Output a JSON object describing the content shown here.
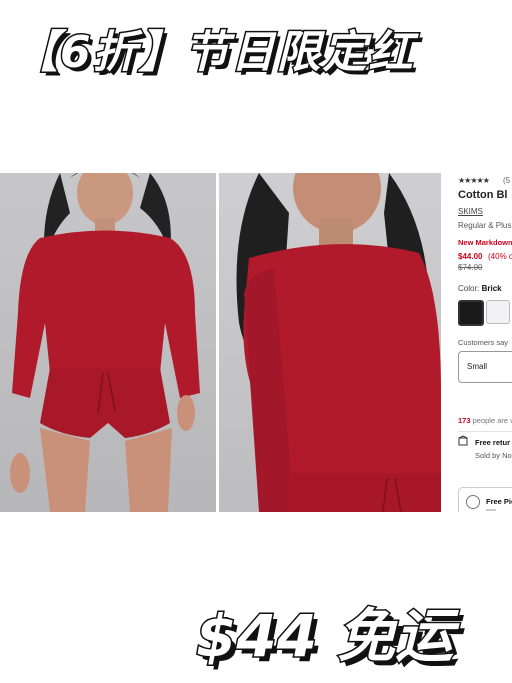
{
  "banner_top": {
    "text": "【6折】节日限定红"
  },
  "banner_bottom": {
    "text": "$44 免运"
  },
  "product": {
    "rating_stars": "★★★★★",
    "review_count": "(5",
    "title": "Cotton Bl",
    "brand": "SKIMS",
    "sizes": "Regular & Plus",
    "markdown_label": "New Markdown",
    "price": "$44.00",
    "discount": "(40% o",
    "original_price": "$74.00",
    "color_label": "Color:",
    "color_value": "Brick",
    "customers_say": "Customers say",
    "size_selected": "Small",
    "people_count": "173",
    "people_text": "people are v",
    "return_text": "Free retur",
    "sold_by": "Sold by No",
    "pickup_text": "Free Pic"
  },
  "colors": {
    "sweater": "#b11a2b",
    "sale": "#d0021b"
  }
}
